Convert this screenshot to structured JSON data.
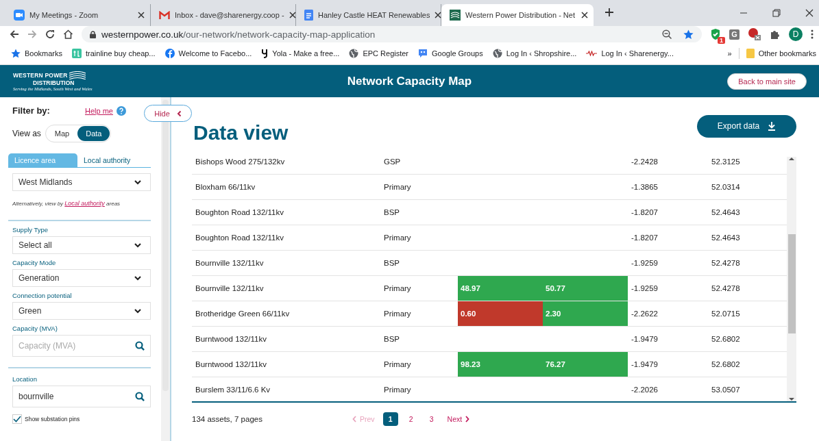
{
  "browser": {
    "tabs": [
      {
        "title": "My Meetings - Zoom",
        "kind": "zoom",
        "selected": false
      },
      {
        "title": "Inbox - dave@sharenergy.coop -",
        "kind": "mail",
        "selected": false
      },
      {
        "title": "Hanley Castle HEAT Renewables",
        "kind": "doc",
        "selected": false
      },
      {
        "title": "Western Power Distribution - Net",
        "kind": "site",
        "selected": true
      }
    ],
    "url": {
      "domain": "westernpower.co.uk",
      "path": "/our-network/network-capacity-map-application"
    },
    "extensions": [
      {
        "kind": "shield",
        "badge": "1"
      },
      {
        "kind": "letter",
        "text": "G"
      },
      {
        "kind": "blocked"
      },
      {
        "kind": "puzzle"
      }
    ],
    "profile": "D",
    "bookmarks": [
      {
        "label": "Bookmarks",
        "kind": "star"
      },
      {
        "label": "trainline buy cheap...",
        "kind": "trainline"
      },
      {
        "label": "Welcome to Facebo...",
        "kind": "facebook"
      },
      {
        "label": "Yola - Make a free...",
        "kind": "yola"
      },
      {
        "label": "EPC Register",
        "kind": "globe"
      },
      {
        "label": "Google Groups",
        "kind": "groups"
      },
      {
        "label": "Log In ‹ Shropshire...",
        "kind": "globe"
      },
      {
        "label": "Log In ‹ Sharenergy...",
        "kind": "wave"
      }
    ],
    "more": "»",
    "other_bookmarks": "Other bookmarks"
  },
  "header": {
    "logo": {
      "top": "WESTERN POWER",
      "bottom": "DISTRIBUTION",
      "tagline": "Serving the Midlands, South West and Wales"
    },
    "title": "Network Capacity Map",
    "back_button": "Back to main site"
  },
  "sidebar": {
    "filter_label": "Filter by:",
    "help_link": "Help me",
    "hide_button": "Hide",
    "view_as": {
      "label": "View as",
      "options": [
        {
          "label": "Map",
          "selected": false
        },
        {
          "label": "Data",
          "selected": true
        }
      ]
    },
    "area_tabs": [
      {
        "label": "Licence area",
        "selected": true
      },
      {
        "label": "Local authority",
        "selected": false
      }
    ],
    "area_select": "West Midlands",
    "note": {
      "prefix": "Alternatively, view by ",
      "link": "Local authority",
      "suffix": " areas"
    },
    "fields": [
      {
        "kind": "select",
        "label": "Supply Type",
        "value": "Select all"
      },
      {
        "kind": "select",
        "label": "Capacity Mode",
        "value": "Generation"
      },
      {
        "kind": "select",
        "label": "Connection potential",
        "value": "Green"
      },
      {
        "kind": "search",
        "label": "Capacity (MVA)",
        "placeholder": "Capacity (MVA)"
      }
    ],
    "location": {
      "label": "Location",
      "value": "bournville"
    },
    "pins": {
      "label": "Show substation pins",
      "checked": true
    }
  },
  "main": {
    "title": "Data view",
    "export_button": "Export data",
    "rows": [
      {
        "column_1": "Bishops Wood 275/132kv",
        "column_2": "GSP",
        "column_3": [],
        "column_4": "-2.2428",
        "column_5": "52.3125"
      },
      {
        "column_1": "Bloxham 66/11kv",
        "column_2": "Primary",
        "column_3": [],
        "column_4": "-1.3865",
        "column_5": "52.0314"
      },
      {
        "column_1": "Boughton Road 132/11kv",
        "column_2": "BSP",
        "column_3": [],
        "column_4": "-1.8207",
        "column_5": "52.4643"
      },
      {
        "column_1": "Boughton Road 132/11kv",
        "column_2": "Primary",
        "column_3": [],
        "column_4": "-1.8207",
        "column_5": "52.4643"
      },
      {
        "column_1": "Bournville 132/11kv",
        "column_2": "BSP",
        "column_3": [],
        "column_4": "-1.9259",
        "column_5": "52.4278"
      },
      {
        "column_1": "Bournville 132/11kv",
        "column_2": "Primary",
        "column_3": [
          {
            "value": "48.97",
            "color": "#2fa84f"
          },
          {
            "value": "50.77",
            "color": "#2fa84f"
          }
        ],
        "column_4": "-1.9259",
        "column_5": "52.4278"
      },
      {
        "column_1": "Brotheridge Green 66/11kv",
        "column_2": "Primary",
        "column_3": [
          {
            "value": "0.60",
            "color": "#c0392b"
          },
          {
            "value": "2.30",
            "color": "#2fa84f"
          }
        ],
        "column_4": "-2.2622",
        "column_5": "52.0715"
      },
      {
        "column_1": "Burntwood 132/11kv",
        "column_2": "BSP",
        "column_3": [],
        "column_4": "-1.9479",
        "column_5": "52.6802"
      },
      {
        "column_1": "Burntwood 132/11kv",
        "column_2": "Primary",
        "column_3": [
          {
            "value": "98.23",
            "color": "#2fa84f"
          },
          {
            "value": "76.27",
            "color": "#2fa84f"
          }
        ],
        "column_4": "-1.9479",
        "column_5": "52.6802"
      },
      {
        "column_1": "Burslem 33/11/6.6 Kv",
        "column_2": "Primary",
        "column_3": [],
        "column_4": "-2.2026",
        "column_5": "53.0507"
      }
    ],
    "summary": "134 assets, 7 pages",
    "pagination": {
      "prev": {
        "label": "Prev",
        "disabled": true
      },
      "pages": [
        {
          "label": "1",
          "selected": true
        },
        {
          "label": "2",
          "selected": false
        },
        {
          "label": "3",
          "selected": false
        }
      ],
      "next": {
        "label": "Next",
        "disabled": false
      }
    }
  }
}
